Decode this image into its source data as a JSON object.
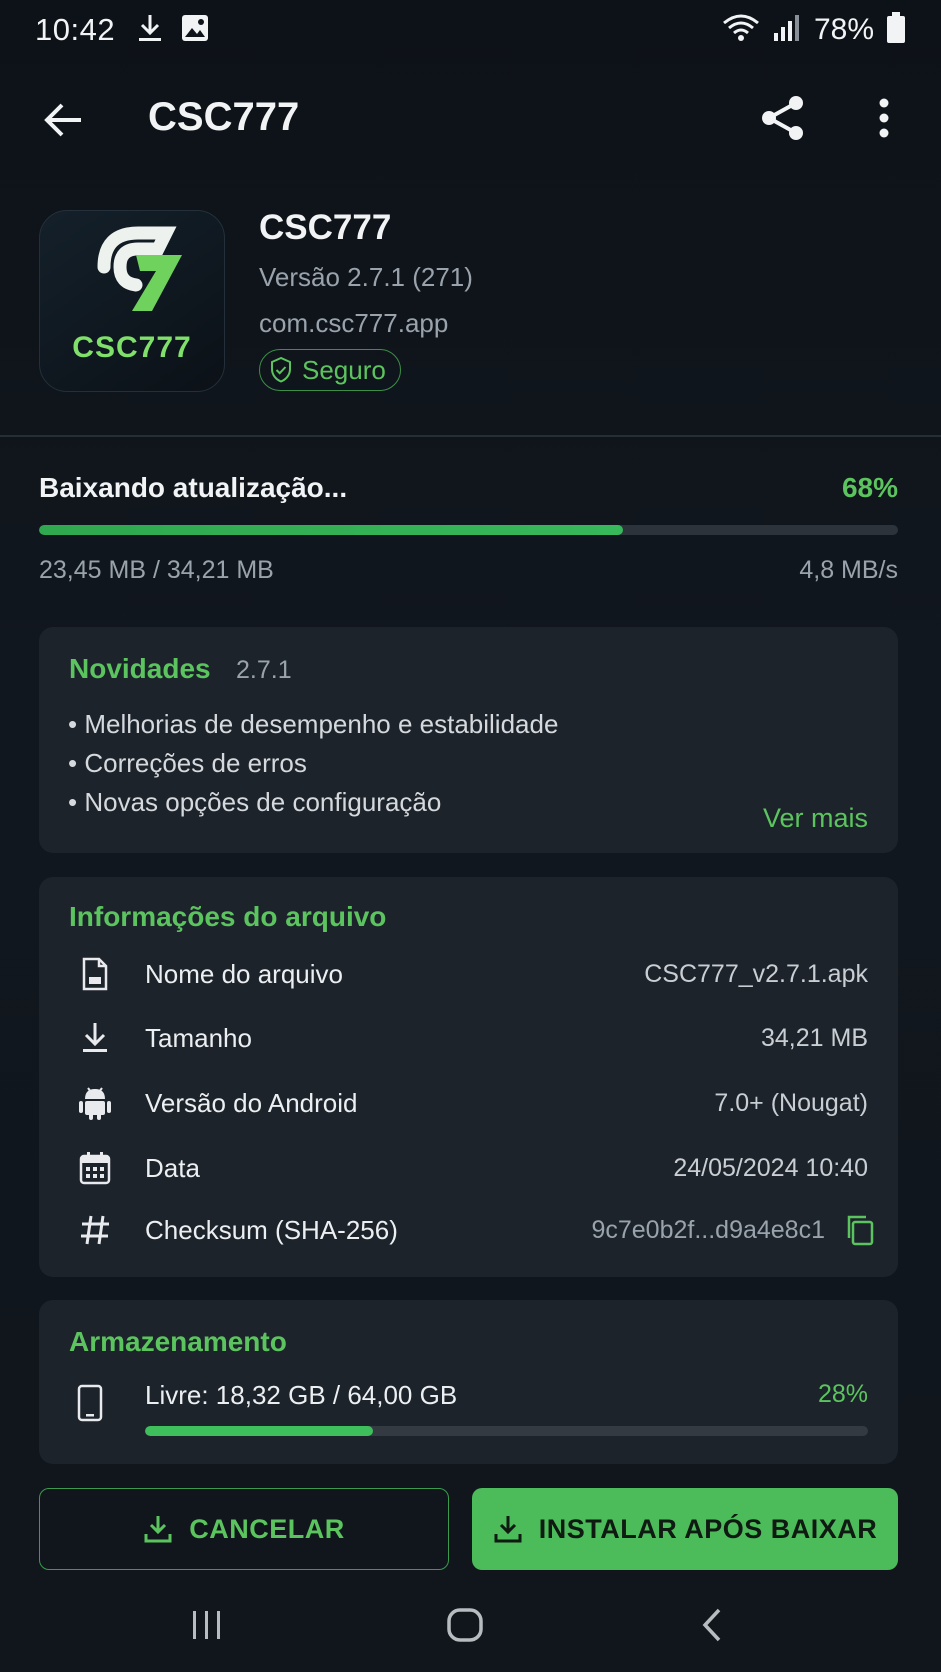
{
  "status_bar": {
    "time": "10:42",
    "battery": "78%",
    "icons": [
      "download-icon",
      "image-icon",
      "wifi-icon",
      "signal-icon",
      "battery-icon"
    ]
  },
  "app_bar": {
    "title": "CSC777",
    "actions": [
      "share-icon",
      "more-vert-icon"
    ]
  },
  "app": {
    "icon_text": "CSC777",
    "name": "CSC777",
    "version": "Versão 2.7.1 (271)",
    "package": "com.csc777.app",
    "badge": "Seguro"
  },
  "download": {
    "label": "Baixando atualização...",
    "percent_text": "68%",
    "progress": 0.68,
    "bytes": "23,45 MB / 34,21 MB",
    "speed": "4,8 MB/s"
  },
  "news": {
    "title": "Novidades",
    "version": "2.7.1",
    "items": [
      "• Melhorias de desempenho e estabilidade",
      "• Correções de erros",
      "• Novas opções de configuração"
    ],
    "more": "Ver mais"
  },
  "file_info": {
    "title": "Informações do arquivo",
    "rows": [
      {
        "label": "Nome do arquivo",
        "value": "CSC777_v2.7.1.apk",
        "icon": "file-icon"
      },
      {
        "label": "Tamanho",
        "value": "34,21 MB",
        "icon": "download-icon"
      },
      {
        "label": "Versão do Android",
        "value": "7.0+ (Nougat)",
        "icon": "android-icon"
      },
      {
        "label": "Data",
        "value": "24/05/2024 10:40",
        "icon": "calendar-icon"
      },
      {
        "label": "Checksum (SHA-256)",
        "value": "9c7e0b2f...d9a4e8c1",
        "icon": "hash-icon"
      }
    ]
  },
  "storage": {
    "title": "Armazenamento",
    "label": "Livre: 18,32 GB / 64,00 GB",
    "percent_text": "28%"
  },
  "buttons": {
    "cancel": "CANCELAR",
    "install": "INSTALAR APÓS BAIXAR"
  },
  "colors": {
    "accent": "#5cc45e",
    "background": "#0f141a",
    "card": "#1c232b",
    "install_button": "#4cbb59"
  }
}
